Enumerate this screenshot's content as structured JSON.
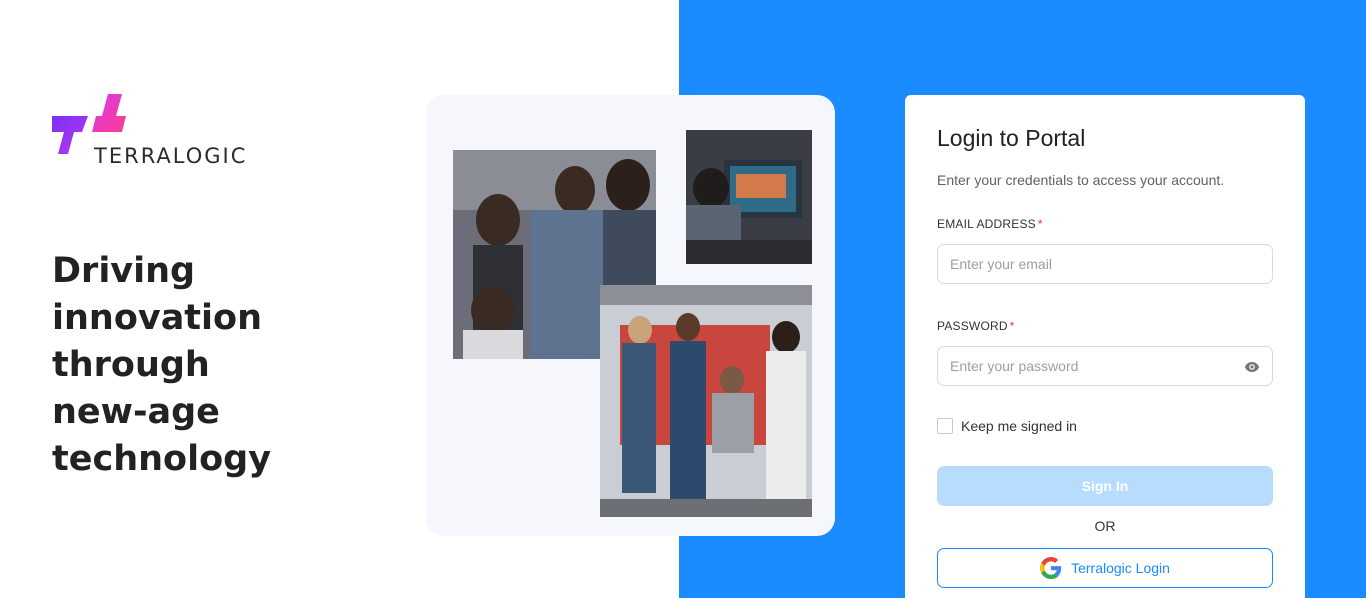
{
  "brand": {
    "name": "TERRALOGIC",
    "logo_icon": "terralogic-logo-icon",
    "colors": {
      "purple": "#7b2ff7",
      "pink": "#f72f9a",
      "primary_blue": "#1a8cff"
    }
  },
  "hero": {
    "headline_lines": [
      "Driving innovation",
      "through",
      "new-age",
      "technology"
    ]
  },
  "login": {
    "title": "Login to Portal",
    "subtitle": "Enter your credentials to access your account.",
    "email": {
      "label": "EMAIL ADDRESS",
      "required_mark": "*",
      "placeholder": "Enter your email",
      "value": ""
    },
    "password": {
      "label": "PASSWORD",
      "required_mark": "*",
      "placeholder": "Enter your password",
      "value": "",
      "toggle_icon": "eye-icon"
    },
    "remember_me": {
      "label": "Keep me signed in",
      "checked": false
    },
    "signin_label": "Sign In",
    "or_label": "OR",
    "sso": {
      "label": "Terralogic Login",
      "icon": "google-icon"
    }
  }
}
